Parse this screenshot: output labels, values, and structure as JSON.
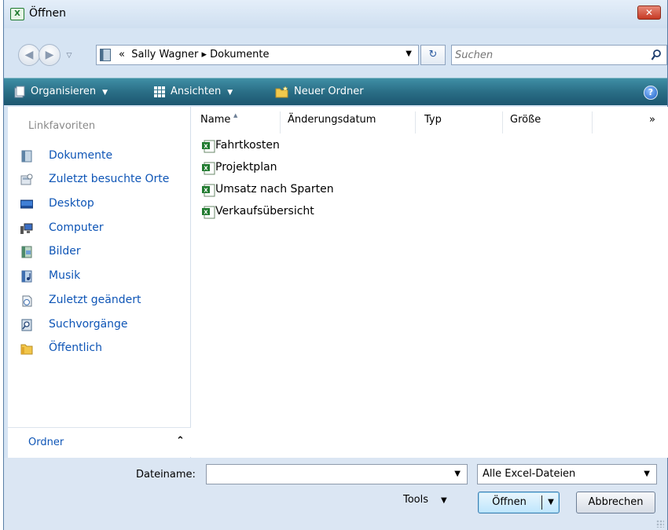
{
  "window": {
    "title": "Öffnen",
    "app_icon": "excel-icon",
    "close_label": "✕"
  },
  "address": {
    "overflow_marker": "«",
    "path": [
      "Sally Wagner",
      "Dokumente"
    ],
    "path_separator": "▸",
    "search_placeholder": "Suchen"
  },
  "toolbar": {
    "organize_label": "Organisieren",
    "views_label": "Ansichten",
    "new_folder_label": "Neuer Ordner",
    "help_label": "?"
  },
  "sidebar": {
    "heading": "Linkfavoriten",
    "items": [
      {
        "label": "Dokumente",
        "icon": "documents-icon"
      },
      {
        "label": "Zuletzt besuchte Orte",
        "icon": "recent-places-icon"
      },
      {
        "label": "Desktop",
        "icon": "desktop-icon"
      },
      {
        "label": "Computer",
        "icon": "computer-icon"
      },
      {
        "label": "Bilder",
        "icon": "pictures-icon"
      },
      {
        "label": "Musik",
        "icon": "music-icon"
      },
      {
        "label": "Zuletzt geändert",
        "icon": "recently-changed-icon"
      },
      {
        "label": "Suchvorgänge",
        "icon": "searches-icon"
      },
      {
        "label": "Öffentlich",
        "icon": "public-folder-icon"
      }
    ],
    "folders_label": "Ordner",
    "folders_chevron": "⌃"
  },
  "file_list": {
    "columns": [
      "Name",
      "Änderungsdatum",
      "Typ",
      "Größe"
    ],
    "more_columns": "»",
    "sorted_column": "Name",
    "files": [
      {
        "name": "Fahrtkosten",
        "icon": "excel-file-icon"
      },
      {
        "name": "Projektplan",
        "icon": "excel-file-icon"
      },
      {
        "name": "Umsatz nach Sparten",
        "icon": "excel-file-icon"
      },
      {
        "name": "Verkaufsübersicht",
        "icon": "excel-file-icon"
      }
    ]
  },
  "bottom": {
    "filename_label": "Dateiname:",
    "filename_value": "",
    "filter_value": "Alle Excel-Dateien",
    "tools_label": "Tools",
    "open_label": "Öffnen",
    "cancel_label": "Abbrechen"
  },
  "colors": {
    "toolbar_top": "#3f8fa5",
    "toolbar_bottom": "#1c5670",
    "link_blue": "#0e55b6",
    "excel_green": "#1f7a2e",
    "close_red": "#c63a24"
  }
}
